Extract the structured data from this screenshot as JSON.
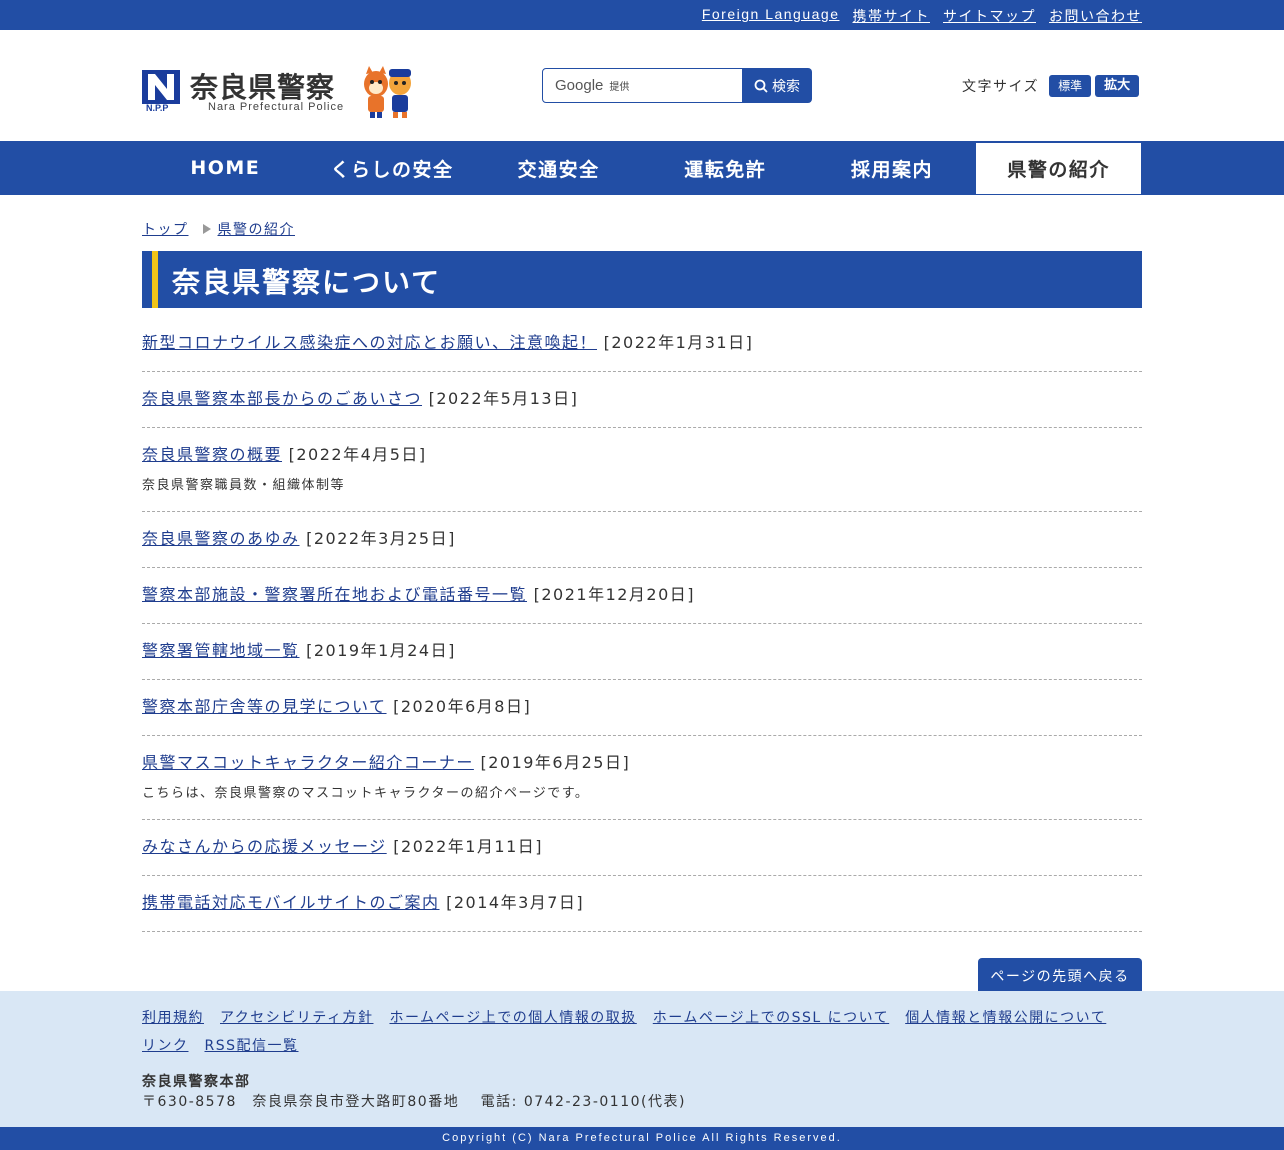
{
  "topbar": {
    "links": [
      "Foreign Language",
      "携帯サイト",
      "サイトマップ",
      "お問い合わせ"
    ]
  },
  "header": {
    "logo_mark": "N.P.P",
    "logo_title": "奈良県警察",
    "logo_subtitle": "Nara Prefectural Police",
    "search_brand": "Google",
    "search_brand_suffix": "提供",
    "search_button": "検索",
    "fontsize_label": "文字サイズ",
    "fontsize_standard": "標準",
    "fontsize_large": "拡大"
  },
  "nav": {
    "items": [
      "HOME",
      "くらしの安全",
      "交通安全",
      "運転免許",
      "採用案内",
      "県警の紹介"
    ]
  },
  "breadcrumb": {
    "top": "トップ",
    "current": "県警の紹介"
  },
  "page_title": "奈良県警察について",
  "articles": [
    {
      "title": "新型コロナウイルス感染症への対応とお願い、注意喚起！",
      "date": "[2022年1月31日]",
      "desc": ""
    },
    {
      "title": "奈良県警察本部長からのごあいさつ",
      "date": "[2022年5月13日]",
      "desc": ""
    },
    {
      "title": "奈良県警察の概要",
      "date": "[2022年4月5日]",
      "desc": "奈良県警察職員数・組織体制等"
    },
    {
      "title": "奈良県警察のあゆみ",
      "date": "[2022年3月25日]",
      "desc": ""
    },
    {
      "title": "警察本部施設・警察署所在地および電話番号一覧",
      "date": "[2021年12月20日]",
      "desc": ""
    },
    {
      "title": "警察署管轄地域一覧",
      "date": "[2019年1月24日]",
      "desc": ""
    },
    {
      "title": "警察本部庁舎等の見学について",
      "date": "[2020年6月8日]",
      "desc": ""
    },
    {
      "title": "県警マスコットキャラクター紹介コーナー",
      "date": "[2019年6月25日]",
      "desc": "こちらは、奈良県警察のマスコットキャラクターの紹介ページです。"
    },
    {
      "title": "みなさんからの応援メッセージ",
      "date": "[2022年1月11日]",
      "desc": ""
    },
    {
      "title": "携帯電話対応モバイルサイトのご案内",
      "date": "[2014年3月7日]",
      "desc": ""
    }
  ],
  "to_top": "ページの先頭へ戻る",
  "footer": {
    "links": [
      "利用規約",
      "アクセシビリティ方針",
      "ホームページ上での個人情報の取扱",
      "ホームページ上でのSSL について",
      "個人情報と情報公開について",
      "リンク",
      "RSS配信一覧"
    ],
    "org": "奈良県警察本部",
    "address": "〒630-8578　奈良県奈良市登大路町80番地　 電話: 0742-23-0110(代表)"
  },
  "copyright": "Copyright (C) Nara Prefectural Police All Rights Reserved.",
  "colors": {
    "primary": "#224ea5",
    "accent": "#f0c419",
    "footer_bg": "#d9e7f5"
  }
}
